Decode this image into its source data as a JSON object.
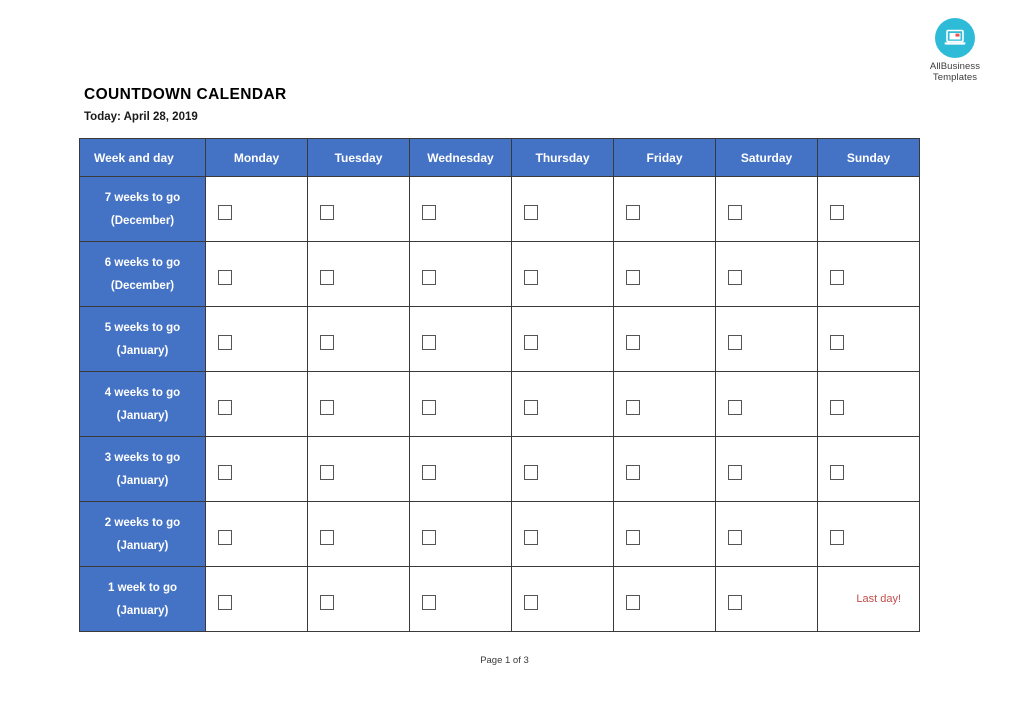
{
  "document": {
    "title": "COUNTDOWN CALENDAR",
    "today_line": "Today: April 28, 2019",
    "footer": "Page 1 of 3"
  },
  "branding": {
    "logo_icon": "laptop-icon",
    "logo_line1": "AllBusiness",
    "logo_line2": "Templates",
    "logo_circle_color": "#2ebbd8"
  },
  "colors": {
    "header_blue": "#4472c4",
    "border_dark": "#3a3a3a",
    "last_day_red": "#c0504d"
  },
  "table": {
    "headers": [
      "Week and day",
      "Monday",
      "Tuesday",
      "Wednesday",
      "Thursday",
      "Friday",
      "Saturday",
      "Sunday"
    ],
    "rows": [
      {
        "week_line1": "7  weeks to go",
        "week_line2": "(December)",
        "cells": [
          {
            "type": "checkbox"
          },
          {
            "type": "checkbox"
          },
          {
            "type": "checkbox"
          },
          {
            "type": "checkbox"
          },
          {
            "type": "checkbox"
          },
          {
            "type": "checkbox"
          },
          {
            "type": "checkbox"
          }
        ]
      },
      {
        "week_line1": "6  weeks to go",
        "week_line2": "(December)",
        "cells": [
          {
            "type": "checkbox"
          },
          {
            "type": "checkbox"
          },
          {
            "type": "checkbox"
          },
          {
            "type": "checkbox"
          },
          {
            "type": "checkbox"
          },
          {
            "type": "checkbox"
          },
          {
            "type": "checkbox"
          }
        ]
      },
      {
        "week_line1": "5 weeks to go",
        "week_line2": "(January)",
        "cells": [
          {
            "type": "checkbox"
          },
          {
            "type": "checkbox"
          },
          {
            "type": "checkbox"
          },
          {
            "type": "checkbox"
          },
          {
            "type": "checkbox"
          },
          {
            "type": "checkbox"
          },
          {
            "type": "checkbox"
          }
        ]
      },
      {
        "week_line1": "4 weeks to go",
        "week_line2": "(January)",
        "cells": [
          {
            "type": "checkbox"
          },
          {
            "type": "checkbox"
          },
          {
            "type": "checkbox"
          },
          {
            "type": "checkbox"
          },
          {
            "type": "checkbox"
          },
          {
            "type": "checkbox"
          },
          {
            "type": "checkbox"
          }
        ]
      },
      {
        "week_line1": "3 weeks to go",
        "week_line2": "(January)",
        "cells": [
          {
            "type": "checkbox"
          },
          {
            "type": "checkbox"
          },
          {
            "type": "checkbox"
          },
          {
            "type": "checkbox"
          },
          {
            "type": "checkbox"
          },
          {
            "type": "checkbox"
          },
          {
            "type": "checkbox"
          }
        ]
      },
      {
        "week_line1": "2 weeks to go",
        "week_line2": "(January)",
        "cells": [
          {
            "type": "checkbox"
          },
          {
            "type": "checkbox"
          },
          {
            "type": "checkbox"
          },
          {
            "type": "checkbox"
          },
          {
            "type": "checkbox"
          },
          {
            "type": "checkbox"
          },
          {
            "type": "checkbox"
          }
        ]
      },
      {
        "week_line1": "1 week to go",
        "week_line2": "(January)",
        "cells": [
          {
            "type": "checkbox"
          },
          {
            "type": "checkbox"
          },
          {
            "type": "checkbox"
          },
          {
            "type": "checkbox"
          },
          {
            "type": "checkbox"
          },
          {
            "type": "checkbox"
          },
          {
            "type": "text",
            "text": "Last day!"
          }
        ]
      }
    ]
  }
}
